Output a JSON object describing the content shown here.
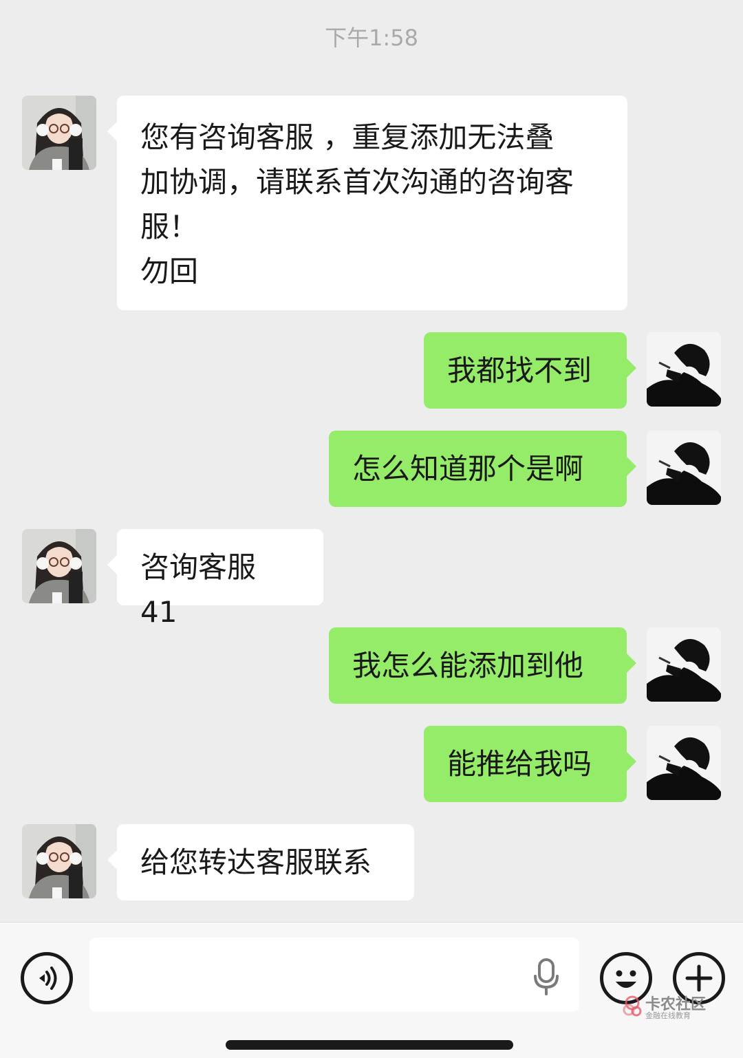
{
  "chat": {
    "timestamp": "下午1:58",
    "messages": [
      {
        "sender": "agent",
        "text": "您有咨询客服 ，重复添加无法叠\n加协调，请联系首次沟通的咨询客\n服！\n勿回"
      },
      {
        "sender": "me",
        "text": "我都找不到"
      },
      {
        "sender": "me",
        "text": "怎么知道那个是啊"
      },
      {
        "sender": "agent",
        "text": "咨询客服 41"
      },
      {
        "sender": "me",
        "text": "我怎么能添加到他"
      },
      {
        "sender": "me",
        "text": "能推给我吗"
      },
      {
        "sender": "agent",
        "text": "给您转达客服联系"
      }
    ]
  },
  "input_bar": {
    "voice_toggle_icon": "voice-wave-icon",
    "mic_icon": "microphone-icon",
    "emoji_icon": "smiley-icon",
    "more_icon": "plus-icon",
    "text_value": ""
  },
  "watermark": {
    "title": "卡农社区",
    "subtitle": "金融在线教育"
  },
  "colors": {
    "background": "#ededed",
    "incoming_bubble": "#ffffff",
    "outgoing_bubble": "#95ec69"
  }
}
